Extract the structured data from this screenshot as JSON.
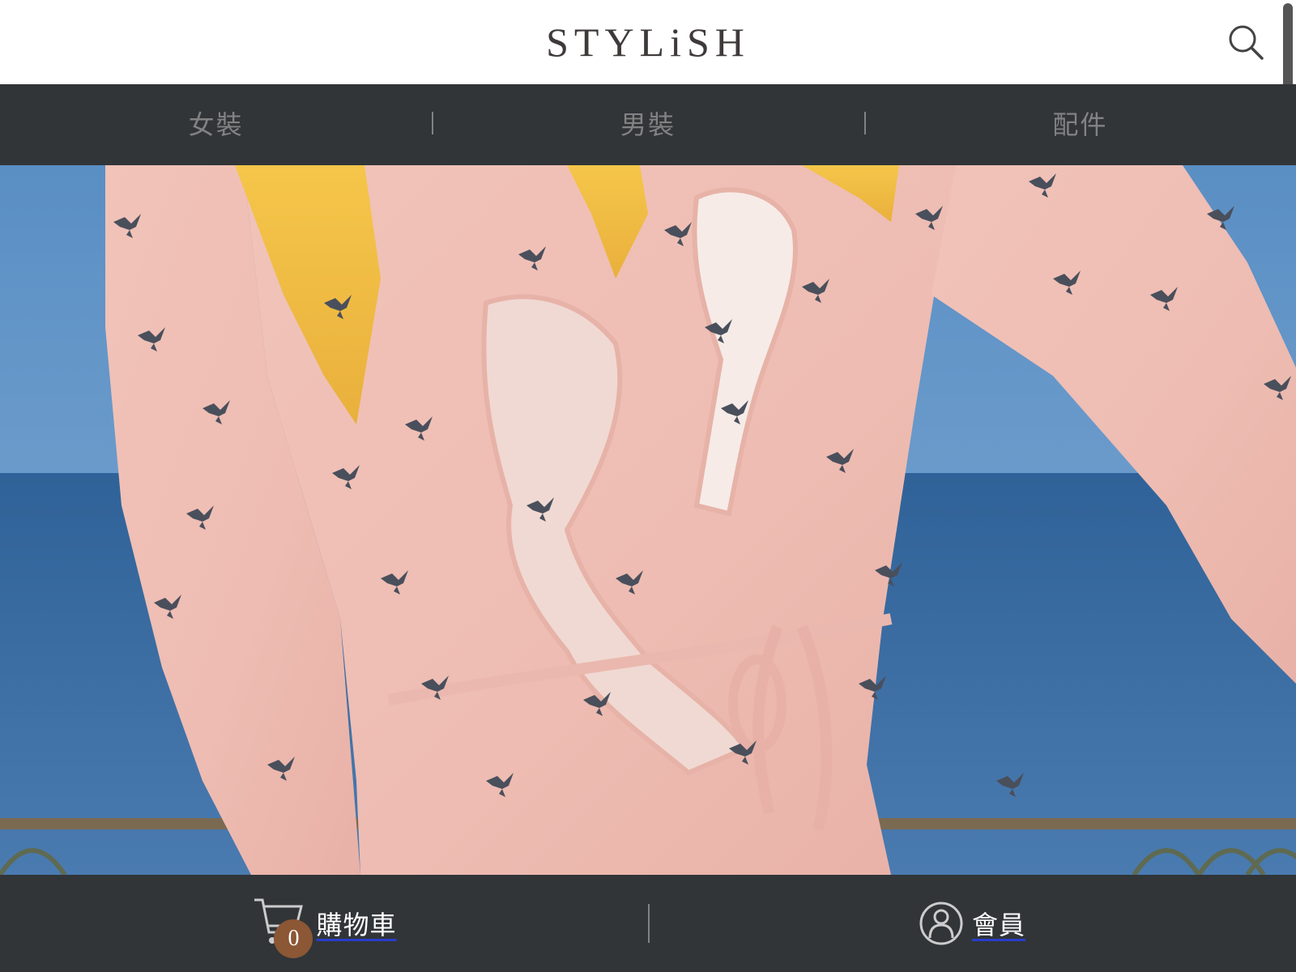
{
  "header": {
    "logo_text": "STYLiSH"
  },
  "categories": [
    {
      "label": "女裝"
    },
    {
      "label": "男裝"
    },
    {
      "label": "配件"
    }
  ],
  "hero": {
    "icon": "dress-photo"
  },
  "bottom_bar": {
    "cart": {
      "label": "購物車",
      "count": "0",
      "icon": "cart-icon"
    },
    "member": {
      "label": "會員",
      "icon": "member-icon"
    }
  },
  "colors": {
    "nav_bg": "#313538",
    "nav_text": "#828282",
    "badge": "#8b5735",
    "logo": "#3f3a3a"
  }
}
